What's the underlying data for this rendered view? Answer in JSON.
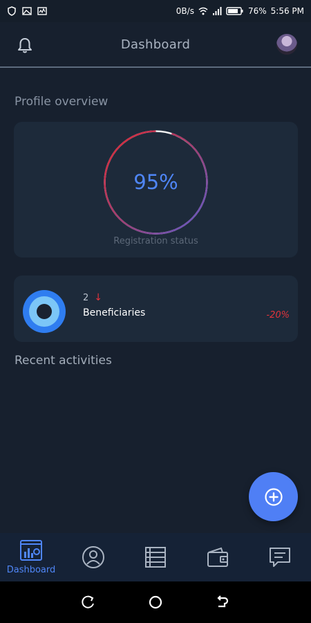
{
  "status_bar": {
    "net_speed": "0B/s",
    "battery": "76%",
    "time": "5:56 PM"
  },
  "app_bar": {
    "title": "Dashboard",
    "left_icon": "bell-icon",
    "right_icon": "avatar"
  },
  "profile_overview": {
    "heading": "Profile overview",
    "percent_label": "95%",
    "progress_fraction": 0.95,
    "caption": "Registration status"
  },
  "beneficiaries_card": {
    "count": "2",
    "trend_icon": "arrow-down-icon",
    "label": "Beneficiaries",
    "change": "-20%"
  },
  "recent_activities": {
    "heading": "Recent activities"
  },
  "fab": {
    "icon": "plus-circle-icon"
  },
  "bottom_nav": {
    "items": [
      {
        "icon": "dashboard-icon",
        "label": "Dashboard",
        "active": true
      },
      {
        "icon": "profile-icon",
        "label": "",
        "active": false
      },
      {
        "icon": "list-icon",
        "label": "",
        "active": false
      },
      {
        "icon": "wallet-icon",
        "label": "",
        "active": false
      },
      {
        "icon": "chat-icon",
        "label": "",
        "active": false
      }
    ]
  },
  "colors": {
    "accent": "#4f86f7",
    "negative": "#e2343c",
    "background": "#17202e",
    "card": "#1d2a3a"
  }
}
